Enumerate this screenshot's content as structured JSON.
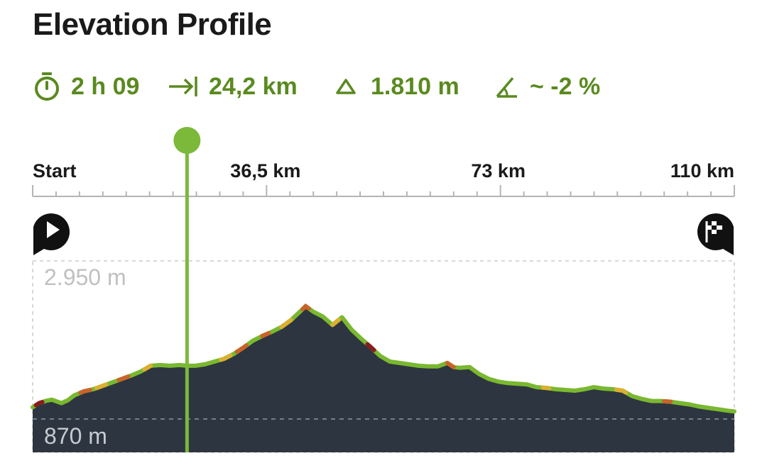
{
  "title": "Elevation Profile",
  "stats": {
    "duration": {
      "icon": "stopwatch-icon",
      "value": "2 h 09"
    },
    "distance": {
      "icon": "distance-arrow-icon",
      "value": "24,2 km"
    },
    "ascent": {
      "icon": "triangle-ascent-icon",
      "value": "1.810 m"
    },
    "gradient": {
      "icon": "slope-angle-icon",
      "value": "~ -2 %"
    }
  },
  "markers": {
    "start": {
      "icon": "start-play-icon"
    },
    "finish": {
      "icon": "finish-flag-icon"
    }
  },
  "colors": {
    "accent": "#7cb93a",
    "stat_text": "#5a8a1f",
    "fill": "#2d3540",
    "line": "#7ab830",
    "steep_moderate": "#d9b030",
    "steep_high": "#c8642a",
    "steep_extreme": "#8b1c1c"
  },
  "chart_data": {
    "type": "area",
    "title": "",
    "xlabel": "",
    "ylabel": "",
    "x_unit": "km",
    "y_unit": "m",
    "x_ticks": [
      {
        "value": 0,
        "label": "Start"
      },
      {
        "value": 36.5,
        "label": "36,5 km"
      },
      {
        "value": 73,
        "label": "73 km"
      },
      {
        "value": 110,
        "label": "110 km"
      }
    ],
    "y_labels": [
      {
        "value": 2950,
        "label": "2.950 m"
      },
      {
        "value": 870,
        "label": "870 m"
      }
    ],
    "xlim": [
      0,
      110
    ],
    "ylim": [
      870,
      2950
    ],
    "grid": false,
    "cursor_km": 24.2,
    "series": [
      {
        "x": [
          0,
          1,
          2,
          3,
          4.5,
          5.5,
          6.5,
          8,
          9.5,
          11,
          12.5,
          14,
          15.5,
          17,
          18.5,
          20,
          21.5,
          23,
          24.2,
          25.5,
          27,
          28.5,
          30,
          31.5,
          33,
          34.5,
          36,
          37.5,
          39,
          40.5,
          42,
          42.8,
          44,
          45.5,
          47,
          48.5,
          50,
          51.5,
          53,
          54.5,
          56,
          57.5,
          59,
          60.5,
          62,
          63.5,
          65,
          66,
          67,
          68.5,
          70,
          71.5,
          73,
          74.5,
          76,
          77.5,
          79,
          80.5,
          82,
          83.5,
          85,
          86.5,
          88,
          89.5,
          91,
          92.5,
          94,
          95.5,
          97,
          98.5,
          100,
          101.5,
          103,
          104.5,
          106,
          107.5,
          109,
          110
        ],
        "y": [
          1040,
          1100,
          1130,
          1150,
          1100,
          1140,
          1210,
          1270,
          1300,
          1350,
          1400,
          1450,
          1500,
          1560,
          1640,
          1650,
          1640,
          1650,
          1640,
          1640,
          1660,
          1700,
          1740,
          1810,
          1900,
          2000,
          2070,
          2130,
          2200,
          2300,
          2430,
          2500,
          2420,
          2350,
          2230,
          2340,
          2160,
          2030,
          1910,
          1780,
          1700,
          1680,
          1660,
          1640,
          1630,
          1630,
          1680,
          1620,
          1610,
          1620,
          1520,
          1450,
          1410,
          1390,
          1380,
          1370,
          1330,
          1320,
          1300,
          1290,
          1280,
          1300,
          1330,
          1310,
          1300,
          1280,
          1200,
          1160,
          1130,
          1130,
          1120,
          1100,
          1080,
          1050,
          1030,
          1010,
          990,
          980
        ]
      }
    ],
    "steep_segments": [
      {
        "x": [
          0.5,
          1.5
        ],
        "level": "extreme"
      },
      {
        "x": [
          7.5,
          9
        ],
        "level": "high"
      },
      {
        "x": [
          10,
          11.5
        ],
        "level": "moderate"
      },
      {
        "x": [
          13.5,
          15
        ],
        "level": "high"
      },
      {
        "x": [
          17.5,
          18.5
        ],
        "level": "moderate"
      },
      {
        "x": [
          29.5,
          31
        ],
        "level": "moderate"
      },
      {
        "x": [
          32,
          33.5
        ],
        "level": "high"
      },
      {
        "x": [
          36,
          37
        ],
        "level": "high"
      },
      {
        "x": [
          39,
          40.5
        ],
        "level": "moderate"
      },
      {
        "x": [
          42.3,
          43.3
        ],
        "level": "high"
      },
      {
        "x": [
          47,
          48
        ],
        "level": "moderate"
      },
      {
        "x": [
          52.5,
          53.5
        ],
        "level": "extreme"
      },
      {
        "x": [
          65,
          66
        ],
        "level": "high"
      },
      {
        "x": [
          80,
          81
        ],
        "level": "moderate"
      },
      {
        "x": [
          91.5,
          93
        ],
        "level": "moderate"
      },
      {
        "x": [
          99,
          100
        ],
        "level": "high"
      }
    ]
  }
}
